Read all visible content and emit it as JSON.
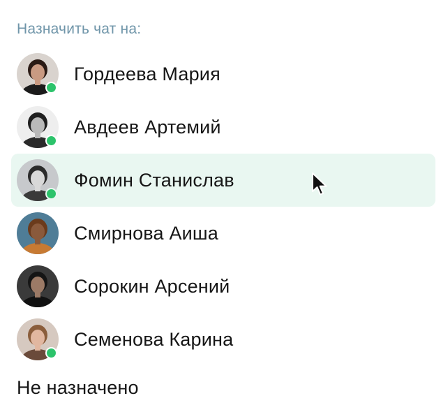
{
  "heading": "Назначить чат на:",
  "users": [
    {
      "name": "Гордеева Мария",
      "online": true,
      "avatar_icon": "avatar-woman-dark-hair",
      "avatar_bg": "#d9d3ce",
      "hair": "#2a1a14",
      "skin": "#c99a82",
      "shirt": "#1b1b1b"
    },
    {
      "name": "Авдеев Артемий",
      "online": true,
      "avatar_icon": "avatar-man-curly-beard",
      "avatar_bg": "#eeeeee",
      "hair": "#1e1e1e",
      "skin": "#b9b9b9",
      "shirt": "#2a2a2a"
    },
    {
      "name": "Фомин Станислав",
      "online": true,
      "avatar_icon": "avatar-man-smiling",
      "avatar_bg": "#c7c9cc",
      "hair": "#2b2b2b",
      "skin": "#d8d8d8",
      "shirt": "#3a3a3a"
    },
    {
      "name": "Смирнова Аиша",
      "online": false,
      "avatar_icon": "avatar-woman-afro",
      "avatar_bg": "#4f7d97",
      "hair": "#6b3b1c",
      "skin": "#8a5a3c",
      "shirt": "#c77a33"
    },
    {
      "name": "Сорокин Арсений",
      "online": false,
      "avatar_icon": "avatar-man-dark-hoodie",
      "avatar_bg": "#3a3a3a",
      "hair": "#151515",
      "skin": "#9c7a66",
      "shirt": "#111111"
    },
    {
      "name": "Семенова Карина",
      "online": true,
      "avatar_icon": "avatar-woman-light-hair",
      "avatar_bg": "#d6c9c0",
      "hair": "#8a5d3b",
      "skin": "#e1b7a0",
      "shirt": "#6a4a3a"
    }
  ],
  "hovered_index": 2,
  "unassigned_label": "Не назначено",
  "colors": {
    "heading": "#6f95a9",
    "hover_bg": "#e9f7f1",
    "online_dot": "#2cc36b",
    "text": "#161616"
  }
}
